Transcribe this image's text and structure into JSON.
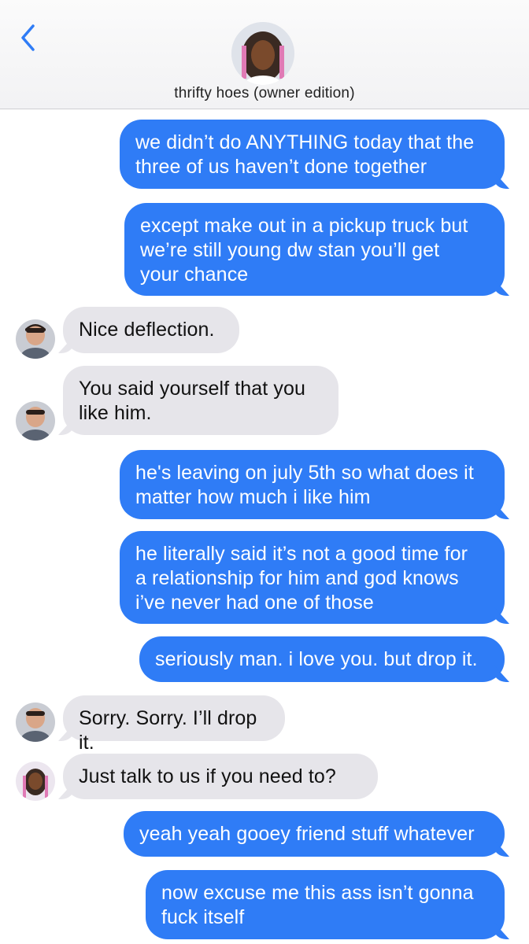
{
  "header": {
    "title": "thrifty hoes (owner edition)",
    "back_icon": "chevron-left-icon",
    "accent_color": "#2f7cf6"
  },
  "messages": [
    {
      "from": "me",
      "text": "we didn’t do ANYTHING today that the\nthree of us haven’t done together"
    },
    {
      "from": "me",
      "text": "except make out in a pickup truck but\nwe’re still young dw stan you’ll get\nyour chance"
    },
    {
      "from": "stan",
      "text": "Nice deflection."
    },
    {
      "from": "stan",
      "text": "You said yourself that you\nlike him."
    },
    {
      "from": "me",
      "text": "he's leaving on july 5th so what does it\nmatter how much i like him"
    },
    {
      "from": "me",
      "text": "he literally said it’s not a good time for\na relationship for him and god knows\ni’ve never had one of those"
    },
    {
      "from": "me",
      "text": "seriously man. i love you. but drop it."
    },
    {
      "from": "stan",
      "text": "Sorry. Sorry. I’ll drop it."
    },
    {
      "from": "friend",
      "text": "Just talk to us if you need to?"
    },
    {
      "from": "me",
      "text": "yeah yeah gooey friend stuff whatever"
    },
    {
      "from": "me",
      "text": "now excuse me this ass isn’t gonna\nfuck itself"
    }
  ],
  "colors": {
    "outgoing_bubble": "#2f7cf6",
    "incoming_bubble": "#e6e5ea"
  }
}
